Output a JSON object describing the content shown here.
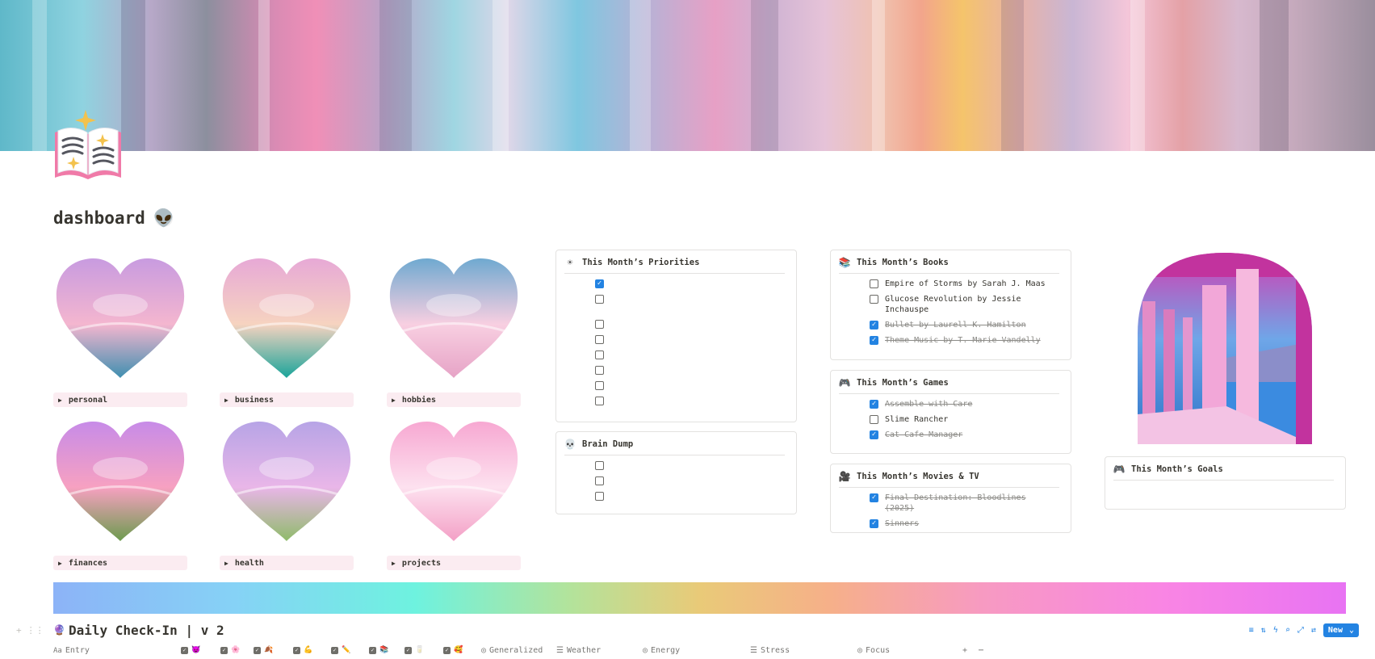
{
  "page": {
    "title": "dashboard",
    "title_emoji": "👽"
  },
  "tiles": [
    {
      "label": "personal",
      "top": "#c89be0",
      "bottom": "#3f8fb0",
      "accent": "#f4b6cf"
    },
    {
      "label": "business",
      "top": "#e7a9d6",
      "bottom": "#1aa49a",
      "accent": "#f6d3c0"
    },
    {
      "label": "hobbies",
      "top": "#6fa9d0",
      "bottom": "#e6a3c6",
      "accent": "#f8cfe1"
    },
    {
      "label": "finances",
      "top": "#c78be8",
      "bottom": "#6c9b4e",
      "accent": "#f7a1c1"
    },
    {
      "label": "health",
      "top": "#b7a4e6",
      "bottom": "#8fbb6a",
      "accent": "#e9b6e8"
    },
    {
      "label": "projects",
      "top": "#f7a8d2",
      "bottom": "#f3a0c6",
      "accent": "#fde1ef"
    }
  ],
  "priorities": {
    "title": "This Month’s Priorities",
    "icon": "sun-icon",
    "items": [
      {
        "text": "",
        "checked": true
      },
      {
        "text": "",
        "checked": false
      },
      {
        "text": "",
        "checked": false
      },
      {
        "text": "",
        "checked": false
      },
      {
        "text": "",
        "checked": false
      },
      {
        "text": "",
        "checked": false
      },
      {
        "text": "",
        "checked": false
      },
      {
        "text": "",
        "checked": false
      }
    ]
  },
  "brain_dump": {
    "title": "Brain Dump",
    "icon": "skull-icon",
    "items": [
      {
        "text": "",
        "checked": false
      },
      {
        "text": "",
        "checked": false
      },
      {
        "text": "",
        "checked": false
      }
    ]
  },
  "books": {
    "title": "This Month’s Books",
    "icon": "book-icon",
    "items": [
      {
        "text": "Empire of Storms by Sarah J. Maas",
        "checked": false
      },
      {
        "text": "Glucose Revolution by Jessie Inchauspe",
        "checked": false
      },
      {
        "text": "Bullet by Laurell K. Hamilton",
        "checked": true
      },
      {
        "text": "Theme Music by T. Marie Vandelly",
        "checked": true
      }
    ]
  },
  "games": {
    "title": "This Month’s Games",
    "icon": "gamepad-icon",
    "items": [
      {
        "text": "Assemble with Care",
        "checked": true
      },
      {
        "text": "Slime Rancher",
        "checked": false
      },
      {
        "text": "Cat Cafe Manager",
        "checked": true
      }
    ]
  },
  "movies": {
    "title": "This Month’s Movies & TV",
    "icon": "camera-icon",
    "items": [
      {
        "text": "Final Destination: Bloodlines (2025)",
        "checked": true
      },
      {
        "text": "Sinners",
        "checked": true
      }
    ]
  },
  "goals": {
    "title": "This Month’s Goals",
    "icon": "gamepad-icon"
  },
  "database": {
    "title": "Daily Check-In | v 2",
    "emoji": "🔮",
    "new_label": "New",
    "properties": {
      "entry": "Entry",
      "generalized": "Generalized",
      "weather": "Weather",
      "energy": "Energy",
      "stress": "Stress",
      "focus": "Focus"
    },
    "checkbox_emojis": [
      "😈",
      "🌸",
      "🍂",
      "💪",
      "✏️",
      "📚",
      "🥛",
      "🥰"
    ]
  }
}
